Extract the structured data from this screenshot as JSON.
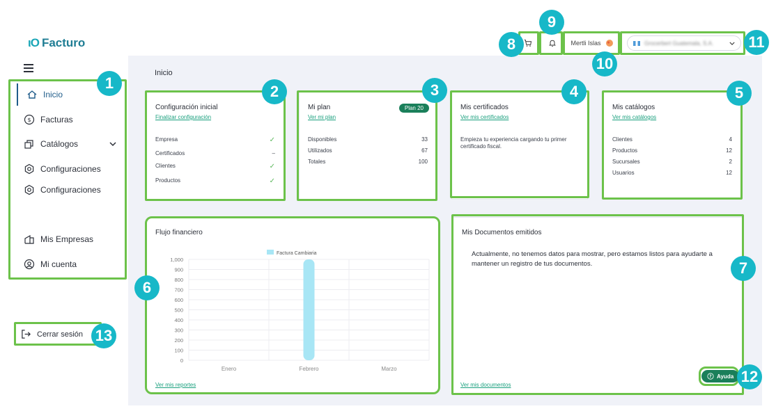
{
  "brand": {
    "mark": "ιO",
    "name": "Facturo"
  },
  "sidebar": {
    "items": [
      {
        "label": "Inicio",
        "icon": "home-icon"
      },
      {
        "label": "Facturas",
        "icon": "dollar-circle-icon"
      },
      {
        "label": "Catálogos",
        "icon": "catalog-icon"
      },
      {
        "label": "Configuraciones",
        "icon": "gear-icon"
      },
      {
        "label": "Configuraciones",
        "icon": "gear-icon"
      },
      {
        "label": "Mis Empresas",
        "icon": "building-icon"
      },
      {
        "label": "Mi cuenta",
        "icon": "user-circle-icon"
      }
    ],
    "logout_label": "Cerrar sesión"
  },
  "topbar": {
    "user_name": "Mertli Islas",
    "company_name": "Grocerbert Guatemala, S.A."
  },
  "page": {
    "title": "Inicio"
  },
  "cards": {
    "config": {
      "title": "Configuración inicial",
      "link": "Finalizar configuración",
      "rows": [
        {
          "label": "Empresa",
          "status": "✓"
        },
        {
          "label": "Certificados",
          "status": "–"
        },
        {
          "label": "Clientes",
          "status": "✓"
        },
        {
          "label": "Productos",
          "status": "✓"
        }
      ]
    },
    "plan": {
      "title": "Mi plan",
      "link": "Ver mi plan",
      "pill": "Plan 20",
      "rows": [
        {
          "label": "Disponibles",
          "value": "33"
        },
        {
          "label": "Utilizados",
          "value": "67"
        },
        {
          "label": "Totales",
          "value": "100"
        }
      ]
    },
    "certs": {
      "title": "Mis certificados",
      "link": "Ver mis certificados",
      "message": "Empieza tu experiencia cargando tu primer certificado fiscal."
    },
    "catalogs": {
      "title": "Mis catálogos",
      "link": "Ver mis catálogos",
      "rows": [
        {
          "label": "Clientes",
          "value": "4"
        },
        {
          "label": "Productos",
          "value": "12"
        },
        {
          "label": "Sucursales",
          "value": "2"
        },
        {
          "label": "Usuarios",
          "value": "12"
        }
      ]
    },
    "flow": {
      "title": "Flujo financiero",
      "link": "Ver mis reportes"
    },
    "docs": {
      "title": "Mis Documentos emitidos",
      "message": "Actualmente, no tenemos datos para mostrar, pero estamos listos para ayudarte a mantener un registro de tus documentos.",
      "link": "Ver mis documentos"
    }
  },
  "help_label": "Ayuda",
  "annotations": [
    "1",
    "2",
    "3",
    "4",
    "5",
    "6",
    "7",
    "8",
    "9",
    "10",
    "11",
    "12",
    "13"
  ],
  "colors": {
    "accent": "#1aa07e",
    "highlight": "#6cc24a",
    "badge": "#17b8c8",
    "bar": "#a8e6f5"
  },
  "chart_data": {
    "type": "bar",
    "categories": [
      "Enero",
      "Febrero",
      "Marzo"
    ],
    "series": [
      {
        "name": "Factura Cambiaria",
        "values": [
          0,
          1000,
          0
        ]
      }
    ],
    "ylim": [
      0,
      1000
    ],
    "yticks": [
      "0",
      "100",
      "200",
      "300",
      "400",
      "500",
      "600",
      "700",
      "800",
      "900",
      "1,000"
    ],
    "grid": true,
    "legend": "top-center"
  }
}
